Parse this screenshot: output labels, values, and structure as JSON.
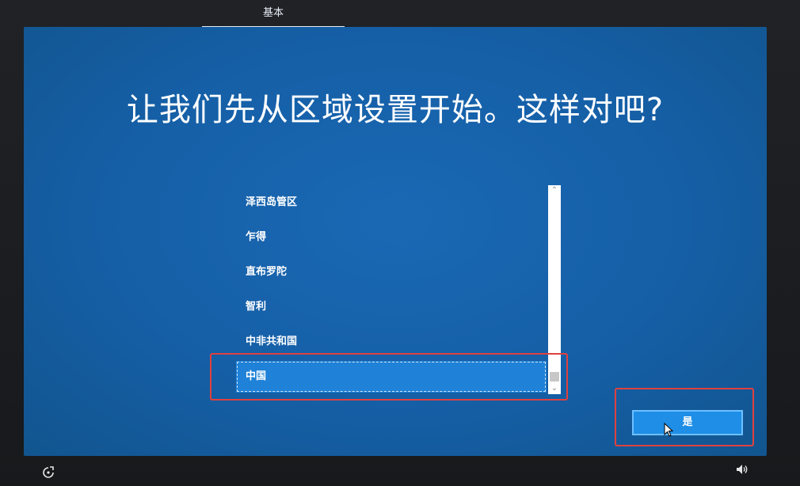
{
  "header": {
    "tab_label": "基本"
  },
  "main": {
    "title": "让我们先从区域设置开始。这样对吧?",
    "regions": [
      {
        "label": "泽西岛管区"
      },
      {
        "label": "乍得"
      },
      {
        "label": "直布罗陀"
      },
      {
        "label": "智利"
      },
      {
        "label": "中非共和国"
      },
      {
        "label": "中国",
        "selected": true
      }
    ],
    "yes_button_label": "是"
  },
  "icons": {
    "scroll_up": "chevron-up-icon",
    "scroll_down": "chevron-down-icon",
    "accessibility": "accessibility-icon",
    "volume": "speaker-icon"
  },
  "colors": {
    "screen_background": "#155fa6",
    "selected_item": "#1f82d8",
    "button": "#1f8ee6",
    "highlight": "#e0413e"
  }
}
